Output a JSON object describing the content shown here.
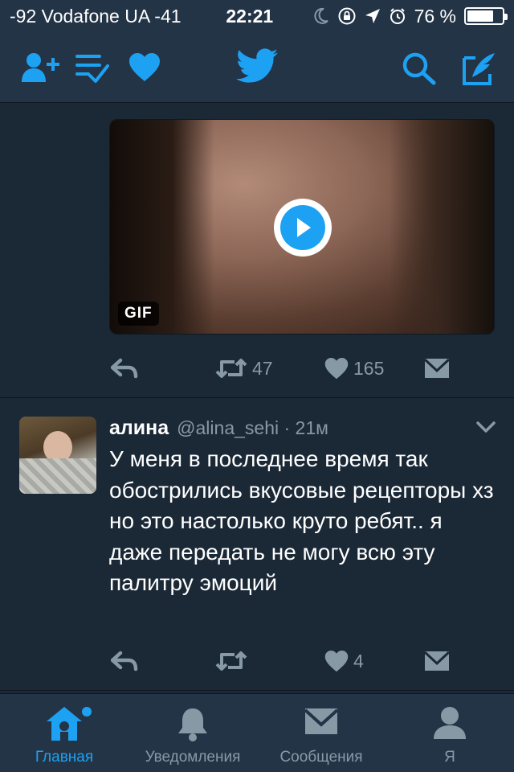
{
  "status_bar": {
    "carrier": "-92 Vodafone UA  -41",
    "time": "22:21",
    "battery": "76 %",
    "battery_level": 0.76
  },
  "nav": {
    "icons": [
      "add-user-icon",
      "lists-icon",
      "heart-icon",
      "twitter-logo-icon",
      "search-icon",
      "compose-icon"
    ]
  },
  "media_tweet": {
    "gif_badge": "GIF",
    "retweets": "47",
    "likes": "165"
  },
  "tweet": {
    "name": "алина",
    "handle": "@alina_sehi · 21м",
    "text": "У меня в последнее время так обострились вкусовые рецепторы хз но это настолько круто ребят.. я даже передать не могу всю эту палитру эмоций",
    "retweets": "",
    "likes": "4"
  },
  "tabs": [
    {
      "label": "Главная",
      "icon": "home-icon",
      "active": true
    },
    {
      "label": "Уведомления",
      "icon": "bell-icon",
      "active": false
    },
    {
      "label": "Сообщения",
      "icon": "envelope-icon",
      "active": false
    },
    {
      "label": "Я",
      "icon": "profile-icon",
      "active": false
    }
  ],
  "colors": {
    "background": "#1b2836",
    "bar": "#243447",
    "accent": "#1da1f2",
    "muted": "#8899a6"
  }
}
